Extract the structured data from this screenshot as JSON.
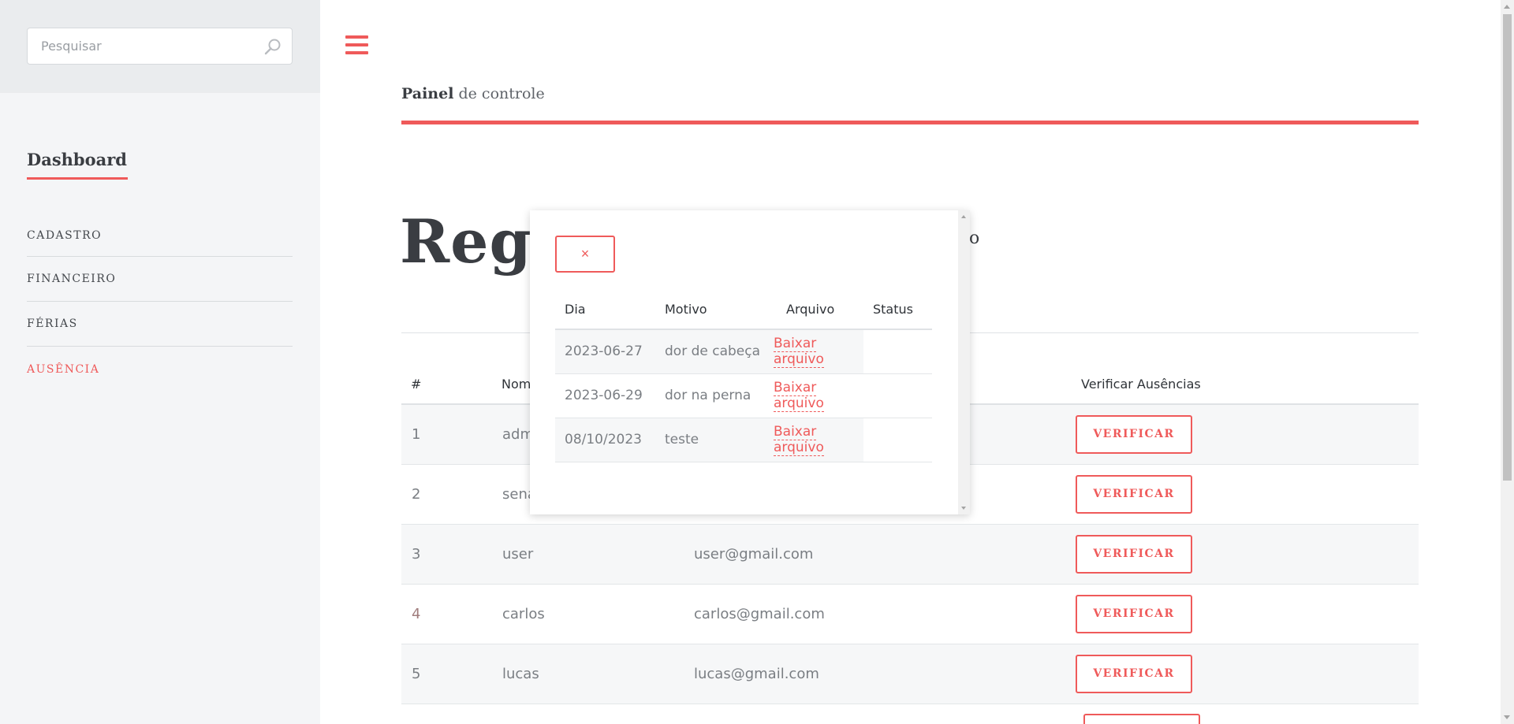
{
  "search": {
    "placeholder": "Pesquisar",
    "icon": "search-icon"
  },
  "sidebar": {
    "title": "Dashboard",
    "items": [
      {
        "label": "CADASTRO",
        "active": false
      },
      {
        "label": "FINANCEIRO",
        "active": false
      },
      {
        "label": "FÉRIAS",
        "active": false
      },
      {
        "label": "AUSÊNCIA",
        "active": true
      }
    ]
  },
  "header": {
    "breadcrumb_bold": "Painel",
    "breadcrumb_rest": " de controle",
    "menu_icon": "hamburger-icon"
  },
  "main": {
    "title": "Regis",
    "title_trailing": "o",
    "table": {
      "headers": [
        "#",
        "Nom",
        "",
        "Verificar Ausências"
      ],
      "rows": [
        {
          "id": "1",
          "name": "adm",
          "email": "",
          "action": "VERIFICAR"
        },
        {
          "id": "2",
          "name": "sena",
          "email": "",
          "action": "VERIFICAR"
        },
        {
          "id": "3",
          "name": "user",
          "email": "user@gmail.com",
          "action": "VERIFICAR"
        },
        {
          "id": "4",
          "name": "carlos",
          "email": "carlos@gmail.com",
          "action": "VERIFICAR"
        },
        {
          "id": "5",
          "name": "lucas",
          "email": "lucas@gmail.com",
          "action": "VERIFICAR"
        }
      ]
    }
  },
  "modal": {
    "close_label": "×",
    "headers": [
      "Dia",
      "Motivo",
      "Arquivo",
      "Status"
    ],
    "rows": [
      {
        "dia": "2023-06-27",
        "motivo": "dor de cabeça",
        "arquivo": "Baixar arquivo",
        "status": ""
      },
      {
        "dia": "2023-06-29",
        "motivo": "dor na perna",
        "arquivo": "Baixar arquivo",
        "status": ""
      },
      {
        "dia": "08/10/2023",
        "motivo": "teste",
        "arquivo": "Baixar arquivo",
        "status": ""
      }
    ]
  },
  "colors": {
    "accent": "#ef5a5a",
    "sidebar_bg": "#f4f5f7",
    "text_dark": "#3a3d42"
  }
}
